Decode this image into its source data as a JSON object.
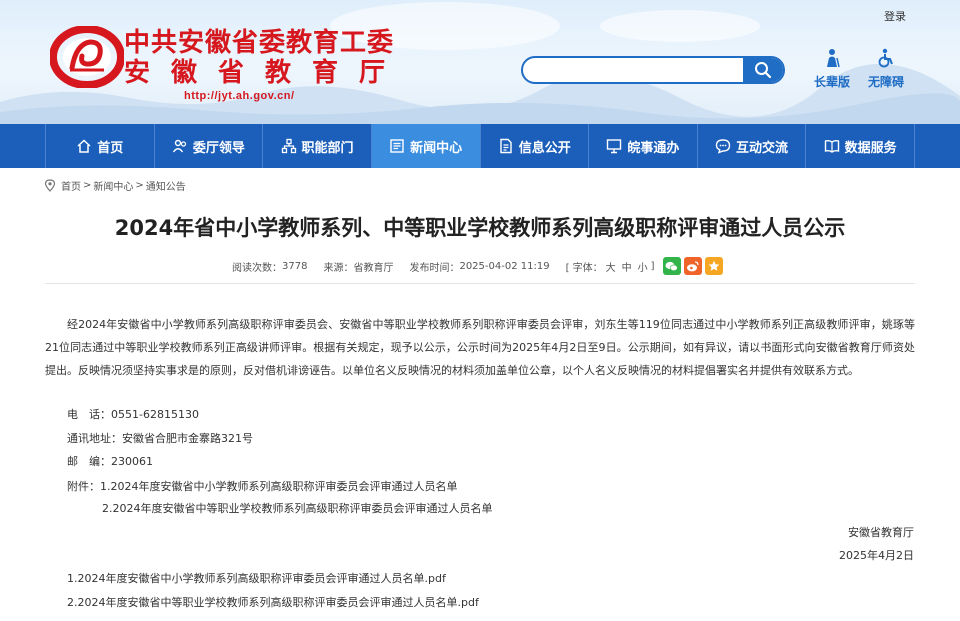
{
  "header": {
    "login": "登录",
    "title_line1": "中共安徽省委教育工委",
    "title_line2": "安徽省教育厅",
    "url": "http://jyt.ah.gov.cn/",
    "search_placeholder": "",
    "elder_label": "长辈版",
    "access_label": "无障碍"
  },
  "nav": {
    "items": [
      {
        "label": "首页",
        "icon": "home-icon"
      },
      {
        "label": "委厅领导",
        "icon": "leaders-icon"
      },
      {
        "label": "职能部门",
        "icon": "org-chart-icon"
      },
      {
        "label": "新闻中心",
        "icon": "news-icon",
        "active": true
      },
      {
        "label": "信息公开",
        "icon": "document-icon"
      },
      {
        "label": "皖事通办",
        "icon": "monitor-icon"
      },
      {
        "label": "互动交流",
        "icon": "chat-icon"
      },
      {
        "label": "数据服务",
        "icon": "book-icon"
      }
    ]
  },
  "breadcrumb": {
    "items": [
      "首页",
      "新闻中心",
      "通知公告"
    ],
    "separator": ">"
  },
  "article": {
    "title": "2024年省中小学教师系列、中等职业学校教师系列高级职称评审通过人员公示",
    "meta": {
      "views_label": "阅读次数：",
      "views": "3778",
      "source_label": "来源：",
      "source": "省教育厅",
      "date_label": "发布时间：",
      "date": "2025-04-02 11:19",
      "font_label": "[ 字体：",
      "font_large": "大",
      "font_medium": "中",
      "font_small": "小",
      "font_close": "]"
    },
    "paragraph": "经2024年安徽省中小学教师系列高级职称评审委员会、安徽省中等职业学校教师系列职称评审委员会评审，刘东生等119位同志通过中小学教师系列正高级教师评审，姚琢等21位同志通过中等职业学校教师系列正高级讲师评审。根据有关规定，现予以公示，公示时间为2025年4月2日至9日。公示期间，如有异议，请以书面形式向安徽省教育厅师资处提出。反映情况须坚持实事求是的原则，反对借机诽谤诬告。以单位名义反映情况的材料须加盖单位公章，以个人名义反映情况的材料提倡署实名并提供有效联系方式。",
    "tel": "电　话：0551-62815130",
    "address": "通讯地址：安徽省合肥市金寨路321号",
    "postcode": "邮　编：230061",
    "attachment1": "附件：1.2024年度安徽省中小学教师系列高级职称评审委员会评审通过人员名单",
    "attachment2": "2.2024年度安徽省中等职业学校教师系列高级职称评审委员会评审通过人员名单",
    "signature": "安徽省教育厅",
    "sign_date": "2025年4月2日",
    "files": [
      "1.2024年度安徽省中小学教师系列高级职称评审委员会评审通过人员名单.pdf",
      "2.2024年度安徽省中等职业学校教师系列高级职称评审委员会评审通过人员名单.pdf"
    ]
  },
  "colors": {
    "brand_red": "#d6171e",
    "nav_blue": "#1b5fbb",
    "nav_active": "#3b8de0"
  }
}
